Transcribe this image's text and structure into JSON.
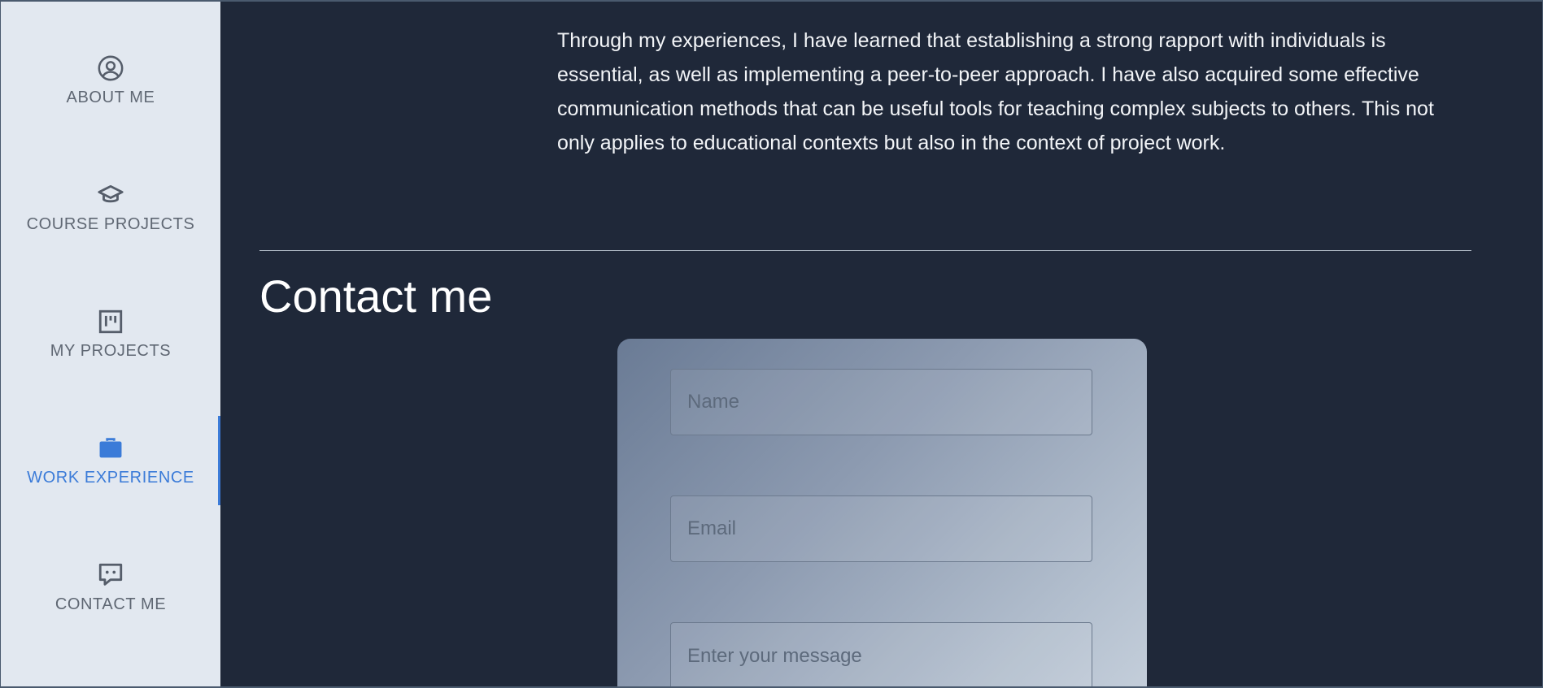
{
  "sidebar": {
    "items": [
      {
        "label": "ABOUT ME",
        "icon": "user-circle-icon",
        "active": false
      },
      {
        "label": "COURSE PROJECTS",
        "icon": "graduation-cap-icon",
        "active": false
      },
      {
        "label": "MY PROJECTS",
        "icon": "kanban-board-icon",
        "active": false
      },
      {
        "label": "WORK EXPERIENCE",
        "icon": "briefcase-icon",
        "active": true
      },
      {
        "label": "CONTACT ME",
        "icon": "chat-bubble-icon",
        "active": false
      }
    ],
    "accent_color": "#3b7bd8"
  },
  "main": {
    "paragraph": "Through my experiences, I have learned that establishing a strong rapport with individuals is essential, as well as implementing a peer-to-peer approach. I have also acquired some effective communication methods that can be useful tools for teaching complex subjects to others. This not only applies to educational contexts but also in the context of project work.",
    "contact_title": "Contact me",
    "form": {
      "name_placeholder": "Name",
      "email_placeholder": "Email",
      "message_placeholder": "Enter your message"
    }
  },
  "colors": {
    "background": "#1f2839",
    "sidebar_bg": "#e2e8f0"
  }
}
